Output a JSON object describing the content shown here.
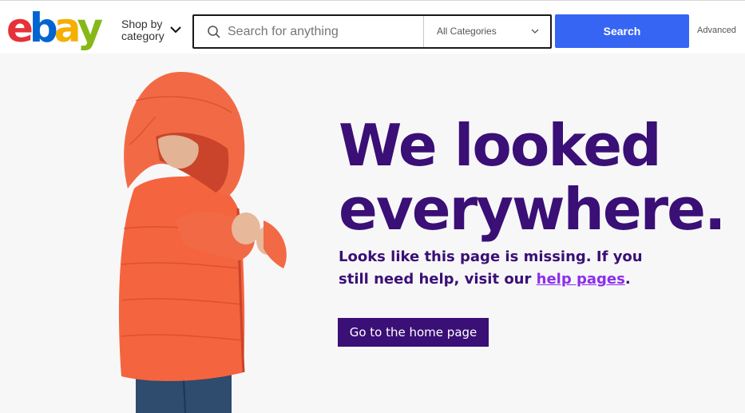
{
  "header": {
    "logo_letters": [
      "e",
      "b",
      "a",
      "y"
    ],
    "logo_colors": [
      "#e53238",
      "#0064d2",
      "#f5af02",
      "#86b817"
    ],
    "shop_by_line1": "Shop by",
    "shop_by_line2": "category",
    "search_placeholder": "Search for anything",
    "category_selected": "All Categories",
    "search_button": "Search",
    "advanced_link": "Advanced"
  },
  "main": {
    "headline_line1": "We looked",
    "headline_line2": "everywhere.",
    "sub_part1": "Looks like this page is missing. If you still need help, visit our ",
    "sub_link": "help pages",
    "sub_part2": ".",
    "home_button": "Go to the home page"
  },
  "colors": {
    "accent_blue": "#3665f3",
    "headline_purple": "#3a0f76",
    "link_purple": "#8d2dee",
    "jacket_orange": "#f4643e",
    "background": "#f7f7f8"
  }
}
